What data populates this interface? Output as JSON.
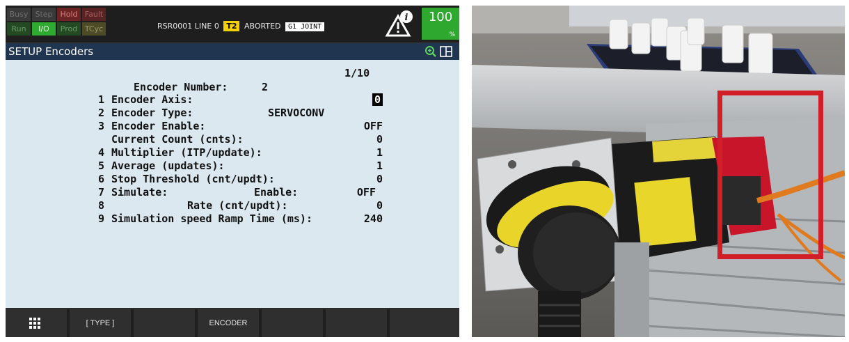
{
  "status": {
    "indicators_top": [
      "Busy",
      "Step",
      "Hold",
      "Fault"
    ],
    "indicators_bottom": [
      "Run",
      "I/O",
      "Prod",
      "TCyc"
    ],
    "program": "RSR0001",
    "line": "LINE 0",
    "mode_tag": "T2",
    "state": "ABORTED",
    "coord_tag": "G1 JOINT",
    "override_value": "100",
    "override_unit": "%"
  },
  "title": "SETUP Encoders",
  "page_indicator": "1/10",
  "encoder_number_label": "Encoder Number:",
  "encoder_number": "2",
  "settings": [
    {
      "num": "1",
      "label": "Encoder Axis:",
      "value": "0"
    },
    {
      "num": "2",
      "label": "Encoder Type:",
      "value": "SERVOCONV"
    },
    {
      "num": "3",
      "label": "Encoder Enable:",
      "value": "OFF"
    },
    {
      "num": "",
      "label": "Current Count (cnts):",
      "value": "0"
    },
    {
      "num": "4",
      "label": "Multiplier (ITP/update):",
      "value": "1"
    },
    {
      "num": "5",
      "label": "Average (updates):",
      "value": "1"
    },
    {
      "num": "6",
      "label": "Stop Threshold (cnt/updt):",
      "value": "0"
    },
    {
      "num": "7",
      "label": "Simulate:",
      "sublabel": "Enable:",
      "value": "OFF"
    },
    {
      "num": "8",
      "label": "",
      "sublabel": "Rate (cnt/updt):",
      "value": "0"
    },
    {
      "num": "9",
      "label": "Simulation speed Ramp Time (ms):",
      "value": "240"
    }
  ],
  "fkeys": [
    "",
    "[ TYPE ]",
    "",
    "ENCODER",
    "",
    "",
    ""
  ],
  "colors": {
    "screen_bg": "#dbe8ef",
    "title_bg": "#1f3550",
    "override_green": "#2ea82e",
    "mode_yellow": "#f5d000",
    "highlight_red": "#d01f26"
  }
}
